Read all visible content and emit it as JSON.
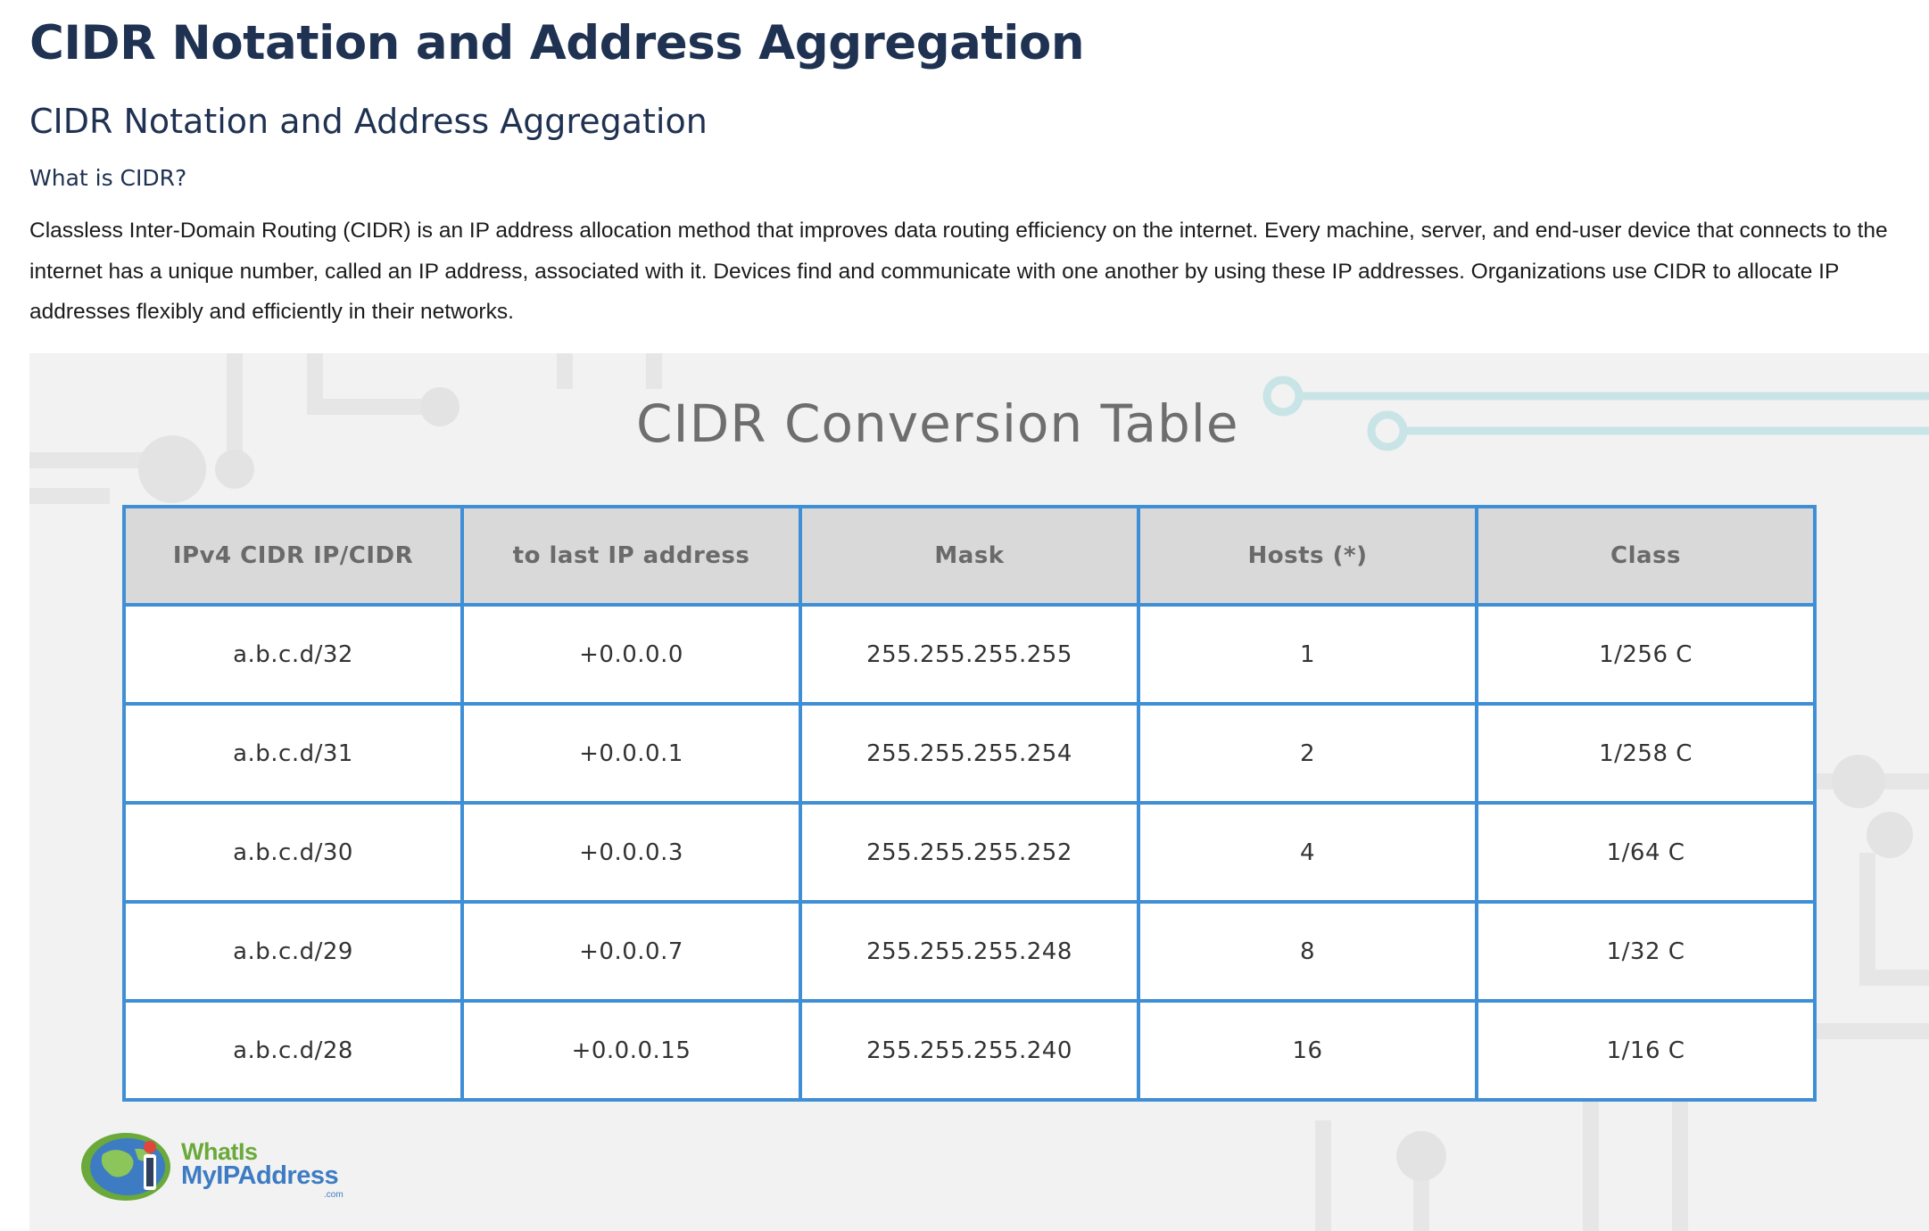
{
  "page": {
    "title": "CIDR Notation and Address Aggregation",
    "subtitle": "CIDR Notation and Address Aggregation",
    "section_heading": "What is CIDR?",
    "paragraph": "Classless Inter-Domain Routing (CIDR) is an IP address allocation method that improves data routing efficiency on the internet. Every machine, server, and end-user device that connects to the internet has a unique number, called an IP address, associated with it. Devices find and communicate with one another by using these IP addresses. Organizations use CIDR to allocate IP addresses flexibly and efficiently in their networks."
  },
  "figure": {
    "title": "CIDR Conversion Table",
    "headers": [
      "IPv4 CIDR IP/CIDR",
      "to last IP address",
      "Mask",
      "Hosts (*)",
      "Class"
    ],
    "rows": [
      [
        "a.b.c.d/32",
        "+0.0.0.0",
        "255.255.255.255",
        "1",
        "1/256 C"
      ],
      [
        "a.b.c.d/31",
        "+0.0.0.1",
        "255.255.255.254",
        "2",
        "1/258 C"
      ],
      [
        "a.b.c.d/30",
        "+0.0.0.3",
        "255.255.255.252",
        "4",
        "1/64 C"
      ],
      [
        "a.b.c.d/29",
        "+0.0.0.7",
        "255.255.255.248",
        "8",
        "1/32 C"
      ],
      [
        "a.b.c.d/28",
        "+0.0.0.15",
        "255.255.255.240",
        "16",
        "1/16 C"
      ]
    ],
    "logo": {
      "line1": "WhatIs",
      "line2": "MyIPAddress",
      "line3": ".com"
    }
  },
  "colors": {
    "heading": "#1f3252",
    "table_border": "#3f8fd6",
    "table_header_bg": "#d9d9d9",
    "figure_bg": "#f2f2f2",
    "logo_green": "#6aa93a",
    "logo_blue": "#3d7cc3"
  }
}
